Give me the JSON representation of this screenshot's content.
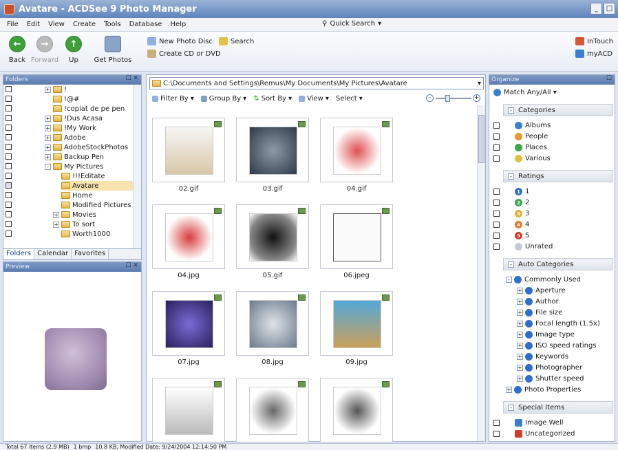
{
  "window": {
    "title": "Avatare - ACDSee 9 Photo Manager"
  },
  "menu": [
    "File",
    "Edit",
    "View",
    "Create",
    "Tools",
    "Database",
    "Help"
  ],
  "quick_search": "Quick Search",
  "toolbar": {
    "back": "Back",
    "forward": "Forward",
    "up": "Up",
    "get_photos": "Get Photos",
    "new_photo_disc": "New Photo Disc",
    "search": "Search",
    "create_cd": "Create CD or DVD",
    "intouch": "InTouch",
    "myacd": "myACD"
  },
  "folders_panel": {
    "title": "Folders",
    "items": [
      "!",
      "!@#",
      "!copiat de pe pen",
      "!Dus Acasa",
      "!My Work",
      "Adobe",
      "AdobeStockPhotos",
      "Backup Pen",
      "My Pictures",
      "!!!Editate",
      "Avatare",
      "Home",
      "Modified Pictures",
      "Movies",
      "To sort",
      "Worth1000"
    ],
    "tabs": [
      "Folders",
      "Calendar",
      "Favorites"
    ]
  },
  "preview_panel": {
    "title": "Preview"
  },
  "main": {
    "path": "C:\\Documents and Settings\\Remus\\My Documents\\My Pictures\\Avatare",
    "filter": "Filter By",
    "group": "Group By",
    "sort": "Sort By",
    "view": "View",
    "select": "Select",
    "thumbs": [
      "02.gif",
      "03.gif",
      "04.gif",
      "04.jpg",
      "05.gif",
      "06.jpeg",
      "07.jpg",
      "08.jpg",
      "09.jpg",
      "",
      "",
      ""
    ]
  },
  "organize": {
    "title": "Organize",
    "match": "Match Any/All",
    "categories_head": "Categories",
    "categories": [
      "Albums",
      "People",
      "Places",
      "Various"
    ],
    "ratings_head": "Ratings",
    "ratings": [
      "1",
      "2",
      "3",
      "4",
      "5",
      "Unrated"
    ],
    "auto_head": "Auto Categories",
    "auto_root": "Commonly Used",
    "auto_items": [
      "Aperture",
      "Author",
      "File size",
      "Focal length (1.5x)",
      "Image type",
      "ISO speed ratings",
      "Keywords",
      "Photographer",
      "Shutter speed"
    ],
    "photo_props": "Photo Properties",
    "special_head": "Special Items",
    "special": [
      "Image Well",
      "Uncategorized"
    ]
  },
  "status": {
    "total": "Total 67 items  (2.9 MB)",
    "sel": "1 bmp",
    "info": "10.8 KB, Modified Date: 9/24/2004 12:14:50 PM"
  }
}
